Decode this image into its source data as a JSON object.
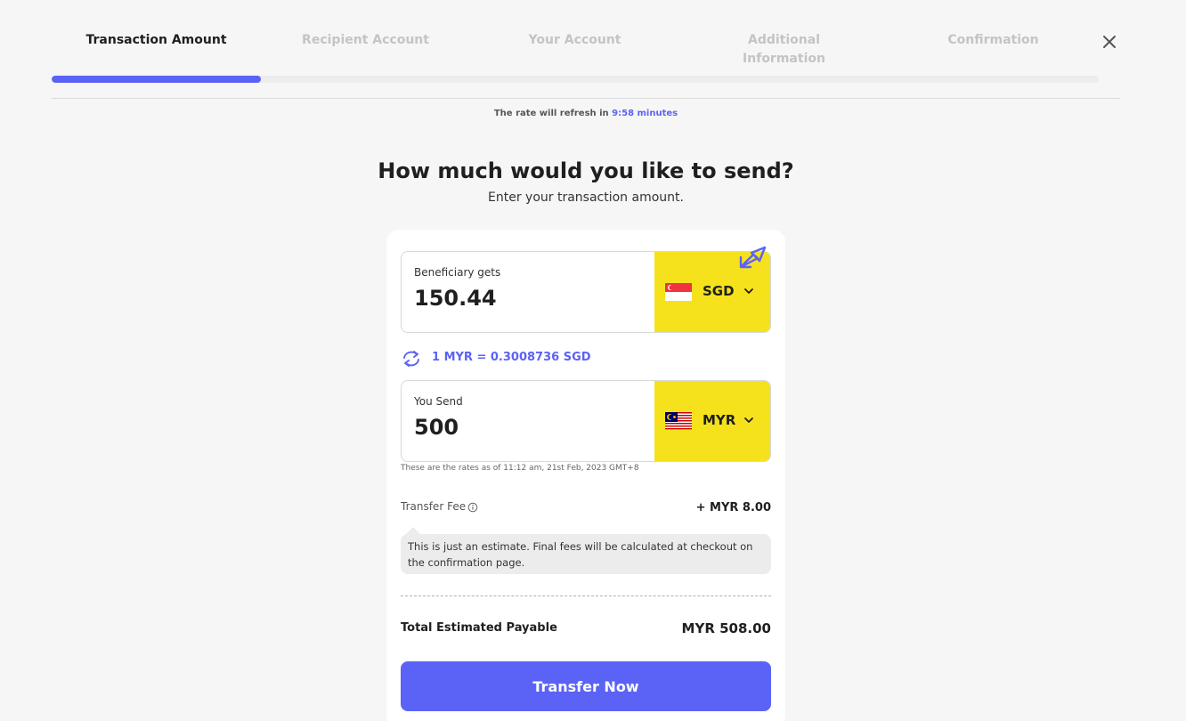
{
  "steps": [
    {
      "label": "Transaction Amount",
      "active": true
    },
    {
      "label": "Recipient Account",
      "active": false
    },
    {
      "label": "Your Account",
      "active": false
    },
    {
      "label": "Additional Information",
      "active": false
    },
    {
      "label": "Confirmation",
      "active": false
    }
  ],
  "progress": {
    "fraction": 0.2
  },
  "refresh": {
    "prefix": "The rate will refresh in",
    "timer": "9:58 minutes"
  },
  "heading": "How much would you like to send?",
  "subheading": "Enter your transaction amount.",
  "beneficiary": {
    "label": "Beneficiary gets",
    "value": "150.44",
    "currency": "SGD",
    "flag": "singapore-flag-icon"
  },
  "rate": {
    "text": "1 MYR = 0.3008736 SGD"
  },
  "sender": {
    "label": "You Send",
    "value": "500",
    "currency": "MYR",
    "flag": "malaysia-flag-icon"
  },
  "rates_asof": "These are the rates as of 11:12 am, 21st Feb, 2023 GMT+8",
  "fee": {
    "label": "Transfer Fee",
    "value": "+ MYR 8.00"
  },
  "estimate_note": "This is just an estimate. Final fees will be calculated at checkout on the confirmation page.",
  "total": {
    "label": "Total Estimated Payable",
    "value": "MYR 508.00"
  },
  "cta": {
    "label": "Transfer Now"
  },
  "colors": {
    "accent": "#5b63f6",
    "currency_bg": "#f5e21c",
    "page_bg": "#f6f6f6"
  }
}
